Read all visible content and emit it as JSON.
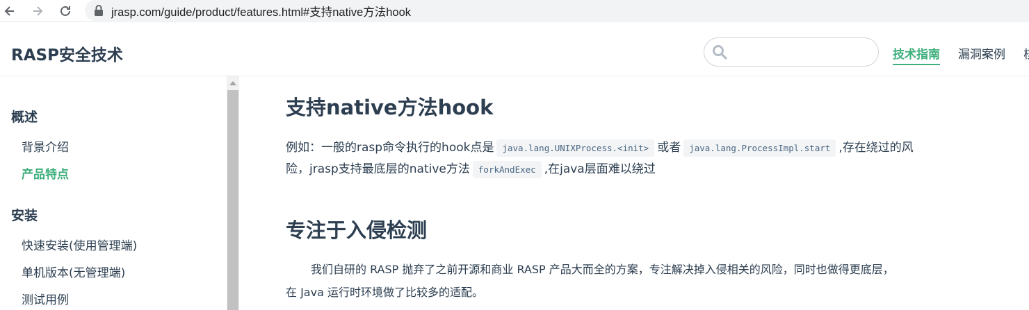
{
  "browser": {
    "url": "jrasp.com/guide/product/features.html#支持native方法hook"
  },
  "header": {
    "site_title": "RASP安全技术",
    "search_placeholder": "",
    "nav": [
      {
        "label": "技术指南",
        "active": true
      },
      {
        "label": "漏洞案例",
        "active": false
      },
      {
        "label": "核",
        "active": false
      }
    ]
  },
  "sidebar": {
    "groups": [
      {
        "title": "概述",
        "items": [
          {
            "label": "背景介绍",
            "active": false
          },
          {
            "label": "产品特点",
            "active": true
          }
        ]
      },
      {
        "title": "安装",
        "items": [
          {
            "label": "快速安装(使用管理端)",
            "active": false
          },
          {
            "label": "单机版本(无管理端)",
            "active": false
          },
          {
            "label": "测试用例",
            "active": false
          }
        ]
      }
    ]
  },
  "content": {
    "section1": {
      "heading": "支持native方法hook",
      "line1_a": "例如：一般的rasp命令执行的hook点是",
      "code1": "java.lang.UNIXProcess.<init>",
      "line1_b": "或者",
      "code2": "java.lang.ProcessImpl.start",
      "line1_c": ",存在绕过的风",
      "line2_a": "险，jrasp支持最底层的native方法",
      "code3": "forkAndExec",
      "line2_b": ",在java层面难以绕过"
    },
    "section2": {
      "heading": "专注于入侵检测",
      "line1": "我们自研的 RASP 抛弃了之前开源和商业 RASP 产品大而全的方案，专注解决掉入侵相关的风险，同时也做得更底层，",
      "line2": "在 Java 运行时环境做了比较多的适配。"
    }
  },
  "colors": {
    "accent": "#3eaf7c",
    "text": "#2c3e50",
    "code_bg": "#f3f4f5",
    "code_text": "#476582"
  }
}
